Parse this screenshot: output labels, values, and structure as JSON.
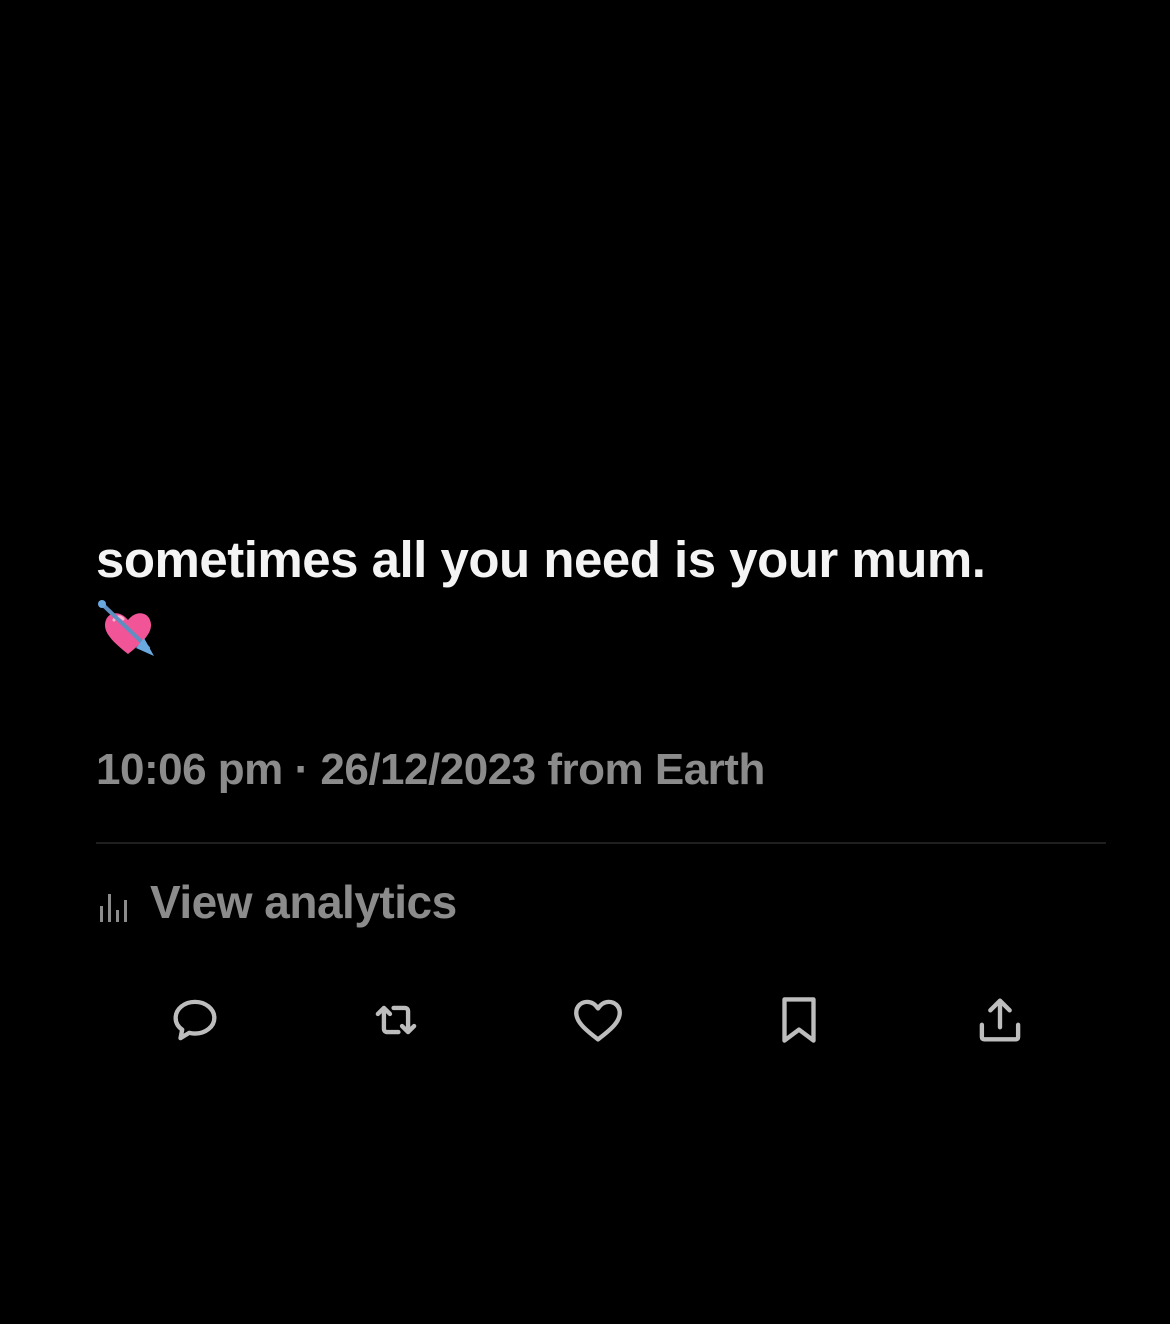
{
  "tweet": {
    "text": "sometimes all you need is your mum.",
    "emoji": "heart-with-arrow"
  },
  "meta": {
    "time": "10:06 pm",
    "separator": "·",
    "date": "26/12/2023",
    "source": "from Earth"
  },
  "analytics": {
    "label": "View analytics",
    "icon": "bar-chart-icon"
  },
  "actions": [
    {
      "name": "reply",
      "icon": "reply-icon"
    },
    {
      "name": "retweet",
      "icon": "retweet-icon"
    },
    {
      "name": "like",
      "icon": "heart-icon"
    },
    {
      "name": "bookmark",
      "icon": "bookmark-icon"
    },
    {
      "name": "share",
      "icon": "share-icon"
    }
  ],
  "colors": {
    "background": "#000000",
    "text": "#f4f4f4",
    "secondary": "#8b8b8b",
    "divider": "#1f1f1f",
    "heart_pink": "#f25597",
    "arrow_blue": "#6aa9e0"
  }
}
